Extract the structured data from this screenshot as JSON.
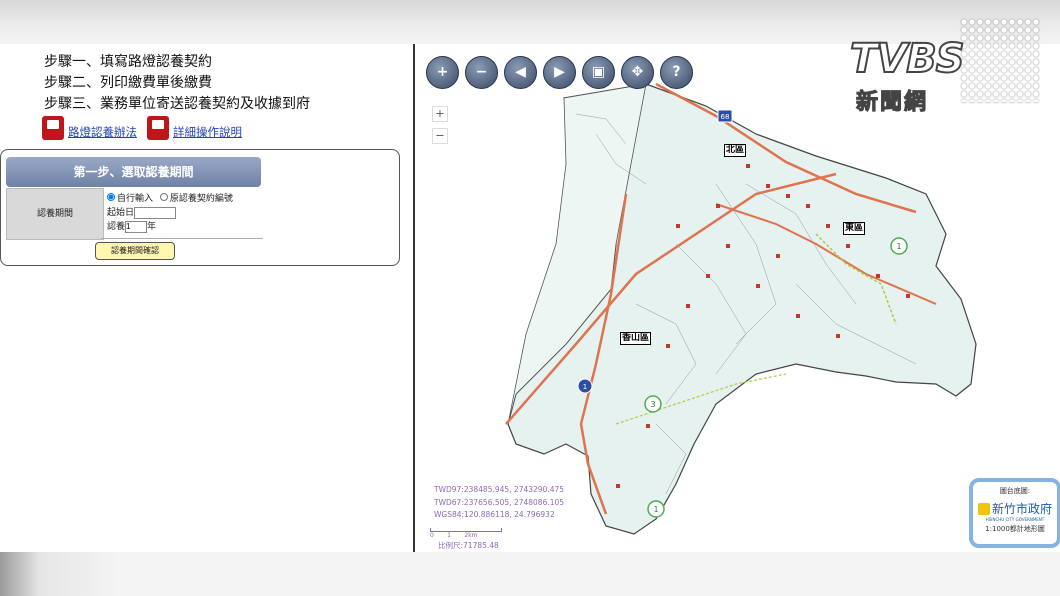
{
  "steps": [
    "步驟一、填寫路燈認養契約",
    "步驟二、列印繳費單後繳費",
    "步驟三、業務單位寄送認養契約及收據到府"
  ],
  "links": {
    "rules": "路燈認養辦法",
    "manual": "詳細操作說明"
  },
  "form": {
    "header": "第一步、選取認養期間",
    "period_label": "認養期間",
    "option_manual": "自行輸入",
    "option_contract": "原認養契約編號",
    "start_label": "起始日",
    "start_value": "",
    "years_label": "認養",
    "years_value": "1",
    "years_unit": "年",
    "confirm_button": "認養期間確認"
  },
  "map": {
    "zoom_in": "+",
    "zoom_out": "−",
    "districts": [
      "北區",
      "東區",
      "香山區"
    ],
    "route_shields": [
      "68",
      "1",
      "1",
      "3",
      "1"
    ],
    "coords": [
      "TWD97:238485.945, 2743290.475",
      "TWD67:237656.505, 2748086.105",
      "WGS84:120.886118, 24.796932"
    ],
    "scale_ticks": "0       1       2km",
    "scale_value": "比例尺:71785.48",
    "basemap_label": "圖台底圖:",
    "basemap_city": "新竹市政府",
    "basemap_city_en": "HSINCHU CITY GOVERNMENT",
    "basemap_desc": "1:1000都計地形圖",
    "nav_icons": [
      "zoom-in-icon",
      "zoom-out-icon",
      "prev-extent-icon",
      "next-extent-icon",
      "full-extent-icon",
      "pan-icon",
      "identify-icon"
    ]
  },
  "watermark": {
    "brand": "TVBS",
    "sub": "新聞網"
  },
  "colors": {
    "map_land": "#e6f2ef",
    "road_main": "#e0734f",
    "panel_header": "#7f8fb0",
    "confirm_button": "#fff6b0"
  }
}
